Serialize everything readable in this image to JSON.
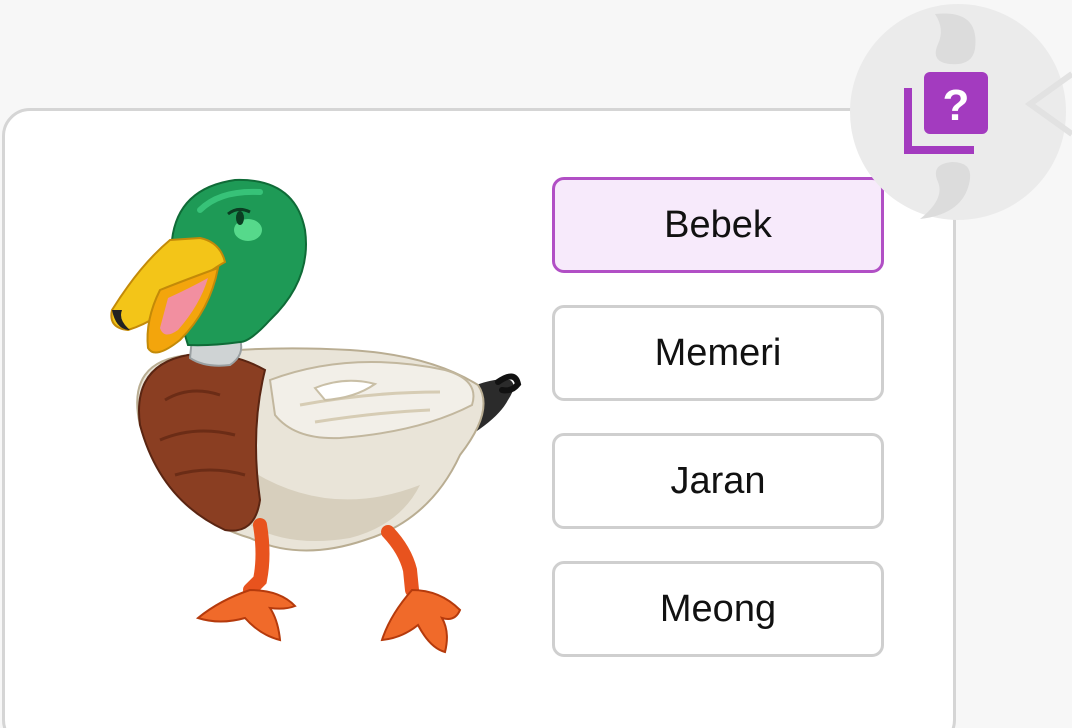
{
  "quiz": {
    "options": [
      {
        "label": "Bebek",
        "selected": true
      },
      {
        "label": "Memeri",
        "selected": false
      },
      {
        "label": "Jaran",
        "selected": false
      },
      {
        "label": "Meong",
        "selected": false
      }
    ]
  },
  "icons": {
    "badge": "question-cards-icon",
    "illustration": "duck-illustration"
  },
  "colors": {
    "accent": "#b14fc5",
    "selected_bg": "#f7eafb",
    "border": "#cfcfcf"
  }
}
